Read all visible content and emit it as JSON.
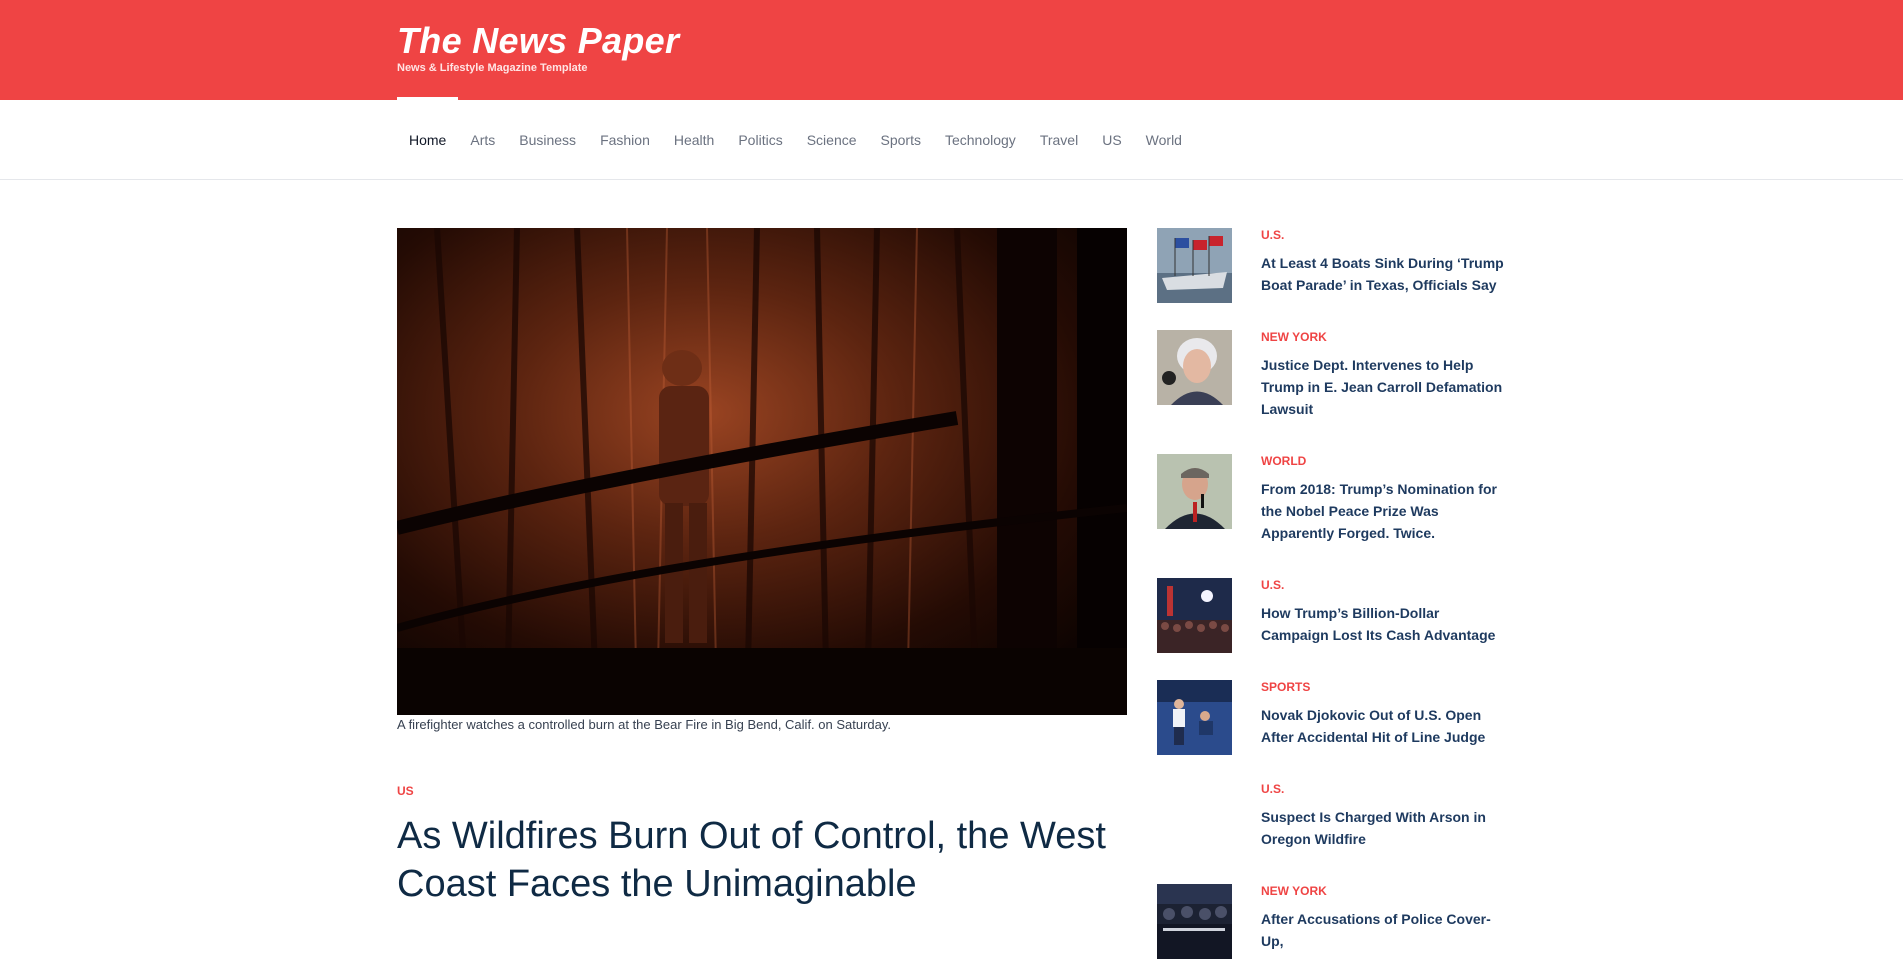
{
  "brand": {
    "title": "The News Paper",
    "subtitle": "News & Lifestyle Magazine Template"
  },
  "nav": {
    "items": [
      {
        "label": "Home",
        "active": true
      },
      {
        "label": "Arts"
      },
      {
        "label": "Business"
      },
      {
        "label": "Fashion"
      },
      {
        "label": "Health"
      },
      {
        "label": "Politics"
      },
      {
        "label": "Science"
      },
      {
        "label": "Sports"
      },
      {
        "label": "Technology"
      },
      {
        "label": "Travel"
      },
      {
        "label": "US"
      },
      {
        "label": "World"
      }
    ]
  },
  "main": {
    "caption": "A firefighter watches a controlled burn at the Bear Fire in Big Bend, Calif. on Saturday.",
    "category": "US",
    "headline": "As Wildfires Burn Out of Control, the West Coast Faces the Unimaginable"
  },
  "sidebar": {
    "stories": [
      {
        "category": "U.S.",
        "title": "At Least 4 Boats Sink During ‘Trump Boat Parade’ in Texas, Officials Say",
        "thumb": "boat-parade"
      },
      {
        "category": "NEW YORK",
        "title": "Justice Dept. Intervenes to Help Trump in E. Jean Carroll Defamation Lawsuit",
        "thumb": "woman-portrait"
      },
      {
        "category": "WORLD",
        "title": "From 2018: Trump’s Nomination for the Nobel Peace Prize Was Apparently Forged. Twice.",
        "thumb": "man-speaking"
      },
      {
        "category": "U.S.",
        "title": "How Trump’s Billion-Dollar Campaign Lost Its Cash Advantage",
        "thumb": "rally-crowd"
      },
      {
        "category": "SPORTS",
        "title": "Novak Djokovic Out of U.S. Open After Accidental Hit of Line Judge",
        "thumb": "tennis-court"
      },
      {
        "category": "U.S.",
        "title": "Suspect Is Charged With Arson in Oregon Wildfire",
        "thumb": ""
      },
      {
        "category": "NEW YORK",
        "title": "After Accusations of Police Cover-Up,",
        "thumb": "police-protest"
      }
    ]
  },
  "colors": {
    "brand_red": "#ef4444",
    "headline_navy": "#0f2a44",
    "link_navy": "#1e3a5f"
  }
}
